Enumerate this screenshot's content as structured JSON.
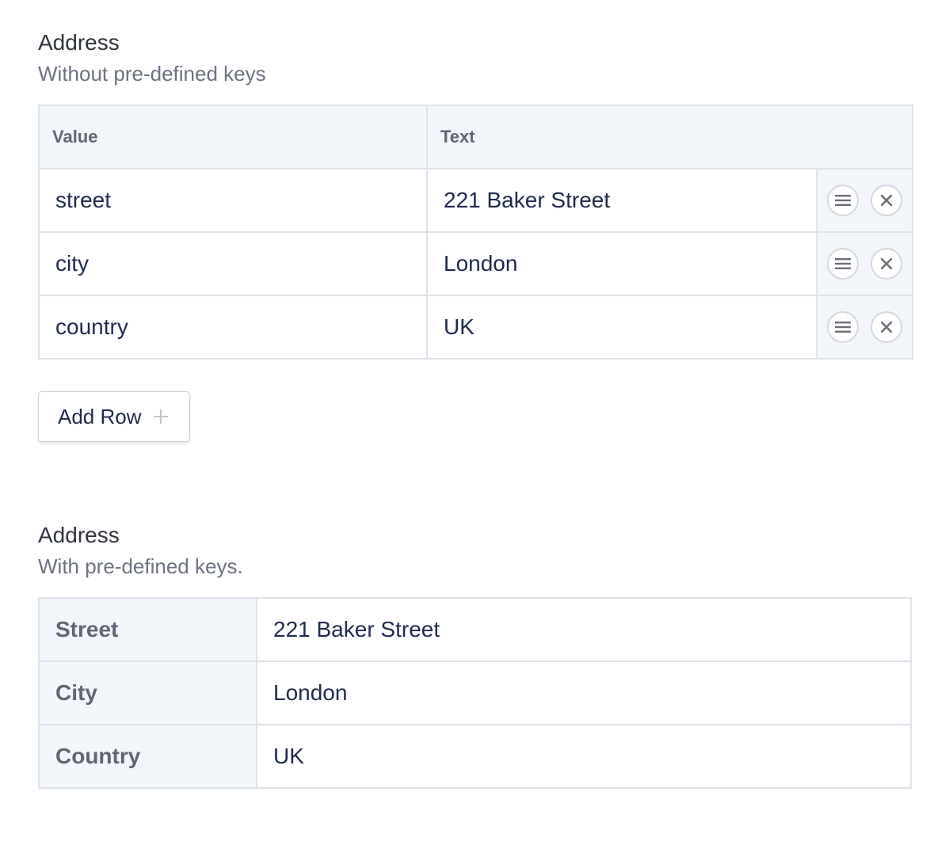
{
  "field_without_keys": {
    "label": "Address",
    "instructions": "Without pre-defined keys",
    "columns": [
      "Value",
      "Text"
    ],
    "rows": [
      {
        "value": "street",
        "text": "221 Baker Street"
      },
      {
        "value": "city",
        "text": "London"
      },
      {
        "value": "country",
        "text": "UK"
      }
    ],
    "add_row_label": "Add Row"
  },
  "field_with_keys": {
    "label": "Address",
    "instructions": "With pre-defined keys.",
    "rows": [
      {
        "key": "Street",
        "value": "221 Baker Street"
      },
      {
        "key": "City",
        "value": "London"
      },
      {
        "key": "Country",
        "value": "UK"
      }
    ]
  },
  "icons": {
    "reorder": "menu-icon",
    "delete": "close-icon",
    "add": "plus-icon"
  },
  "colors": {
    "header_bg": "#f2f5f9",
    "border": "#dde3ea",
    "text": "#1f2a4d",
    "muted": "#6b7280"
  }
}
